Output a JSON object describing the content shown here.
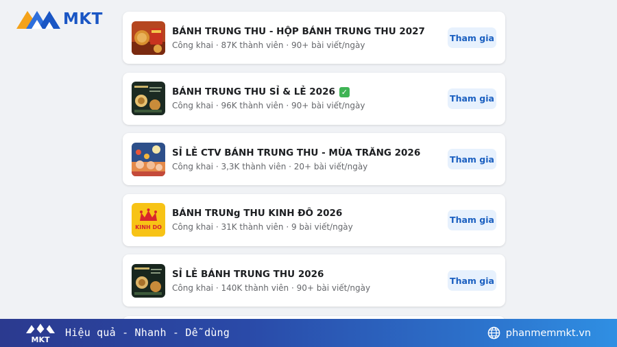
{
  "brand": {
    "logo_text": "MKT",
    "colors": {
      "primary": "#1a56c4",
      "footer_start": "#2b3a8f",
      "footer_end": "#2f8fe3"
    }
  },
  "groups": [
    {
      "title": "BÁNH TRUNG THU - HỘP BÁNH TRUNG THU 2027",
      "meta": "Công khai · 87K thành viên · 90+ bài viết/ngày",
      "verified": false,
      "thumb_icon": "mooncake-box-photo",
      "join_label": "Tham gia"
    },
    {
      "title": "BÁNH TRUNG THU SỈ & LẺ 2026",
      "meta": "Công khai · 96K thành viên · 90+ bài viết/ngày",
      "verified": true,
      "verified_glyph": "✓",
      "thumb_icon": "mooncake-poster-photo",
      "join_label": "Tham gia"
    },
    {
      "title": "SỈ LẺ CTV BÁNH TRUNG THU - MÙA TRĂNG 2026",
      "meta": "Công khai · 3,3K thành viên · 20+ bài viết/ngày",
      "verified": false,
      "thumb_icon": "lantern-festival-photo",
      "join_label": "Tham gia"
    },
    {
      "title": "BÁNH TRUNg THU KINH ĐÔ 2026",
      "meta": "Công khai · 31K thành viên · 9 bài viết/ngày",
      "verified": false,
      "thumb_icon": "kinh-do-logo",
      "thumb_text": "KINH DO",
      "join_label": "Tham gia"
    },
    {
      "title": "SỈ LẺ BÁNH TRUNG THU 2026",
      "meta": "Công khai · 140K thành viên · 90+ bài viết/ngày",
      "verified": false,
      "thumb_icon": "mooncake-poster-photo",
      "join_label": "Tham gia"
    }
  ],
  "footer": {
    "logo_text": "MKT",
    "slogan": "Hiệu quả - Nhanh - Dễ dùng",
    "website": "phanmemmkt.vn",
    "website_icon": "globe-icon"
  }
}
